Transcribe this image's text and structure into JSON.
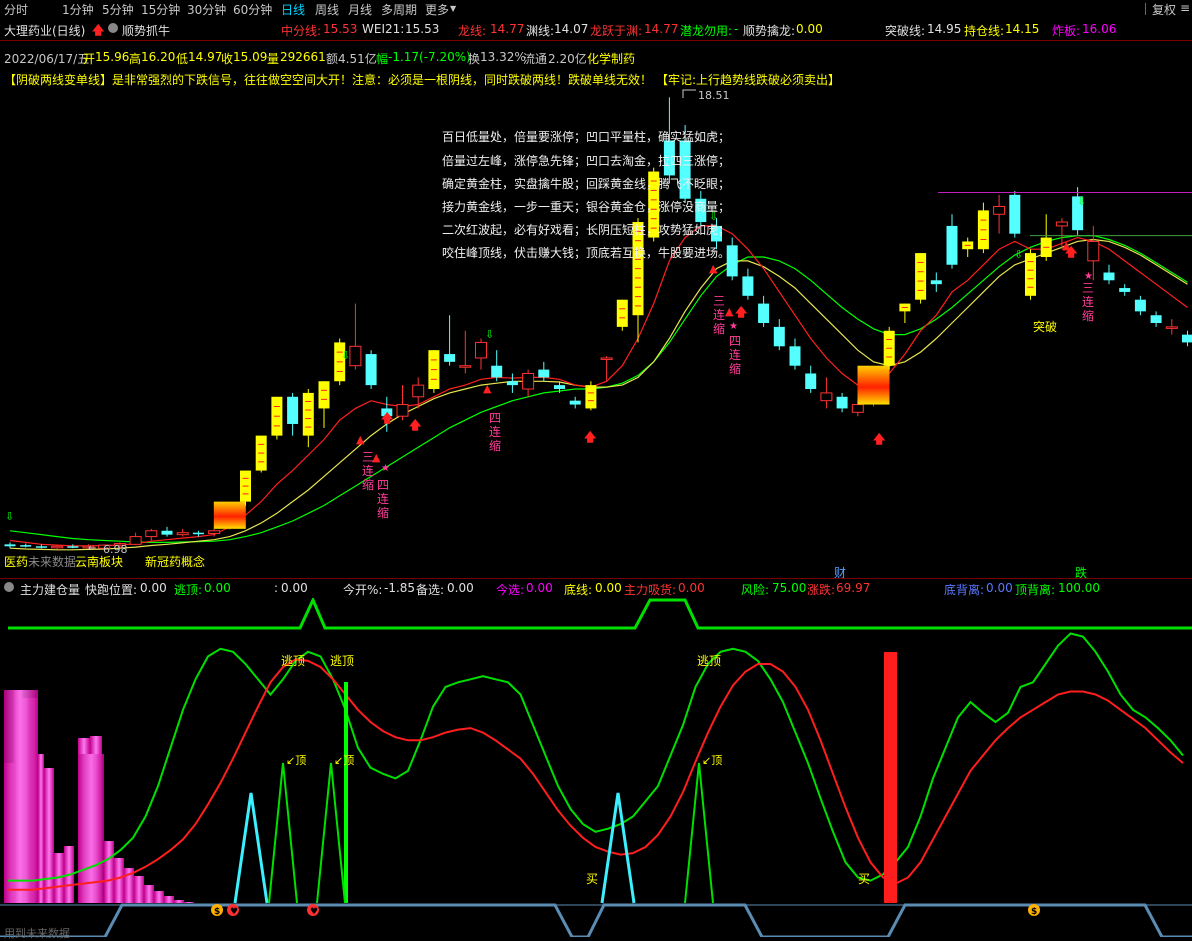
{
  "toolbar": {
    "tabs": [
      "分时",
      "1分钟",
      "5分钟",
      "15分钟",
      "30分钟",
      "60分钟",
      "日线",
      "周线",
      "月线",
      "多周期",
      "更多"
    ],
    "active": "日线",
    "restore": "复权",
    "menu": "≡"
  },
  "title": {
    "stock": "大理药业(日线)",
    "strategy": "顺势抓牛",
    "mid_label": "中分线:",
    "mid_value": "15.53",
    "wei_label": "WEI21:",
    "wei_value": "15.53",
    "long_label": "龙线:",
    "long_value": "14.77",
    "deep_label": "渊线:",
    "deep_value": "14.07",
    "jump_label": "龙跃于渊:",
    "jump_value": "14.77",
    "hide_label": "潜龙勿用:",
    "hide_value": "-",
    "trend_label": "顺势擒龙:",
    "trend_value": "0.00",
    "break_label": "突破线:",
    "break_value": "14.95",
    "hold_label": "持仓线:",
    "hold_value": "14.15",
    "burst_label": "炸板:",
    "burst_value": "16.06"
  },
  "info": {
    "date": "2022/06/17/五",
    "open_label": "开",
    "open": "15.96",
    "high_label": "高",
    "high": "16.20",
    "low_label": "低",
    "low": "14.97",
    "close_label": "收",
    "close": "15.09",
    "vol_label": "量",
    "vol": "292661",
    "amount_label": "额",
    "amount": "4.51亿",
    "chg_label": "幅",
    "chg": "-1.17(-7.20%)",
    "turn_label": "换",
    "turn": "13.32%",
    "float_label": "流通",
    "float": "2.20亿",
    "sector": "化学制药"
  },
  "warning": {
    "part1": "【阴破两线变单线】是非常强烈的下跌信号，往往做空空间大开！注意：必须是一根阴线，同时跌破两线！跌破单线无效！",
    "part2": "【牢记:上行趋势线跌破必须卖出】"
  },
  "poem": [
    "百日低量处，倍量要涨停；凹口平量柱，确实猛如虎；",
    "倍量过左峰，涨停急先锋；凹口去淘金，拉四三涨停；",
    "确定黄金柱，实盘擒牛股；回踩黄金线，腾飞不眨眼；",
    "接力黄金线，一步一重天；银谷黄金仓，涨停没商量；",
    "二次红波起，必有好戏看；长阴压短柱，攻势猛如虎；",
    "咬住峰顶线，伏击赚大钱；顶底若互换，牛股要进场。"
  ],
  "annotations": {
    "high_price": "18.51",
    "low_price": "6.98",
    "breakthrough": "突破",
    "three_shrink": "三连缩",
    "four_shrink": "四连缩",
    "sectors": [
      "医药",
      "未来数据",
      "云南板块",
      "新冠药概念"
    ],
    "cai": "财",
    "die": "跌"
  },
  "indicator": {
    "name": "主力建仓量",
    "quick_label": "快跑位置:",
    "quick": "0.00",
    "escape_label": "逃顶:",
    "escape": "0.00",
    "colon": ":",
    "colon_value": "0.00",
    "today_label": "今开%:",
    "today": "-1.85",
    "prep_label": "备选:",
    "prep": "0.00",
    "pick_label": "今选:",
    "pick": "0.00",
    "bottom_label": "底线:",
    "bottom": "0.00",
    "absorb_label": "主力吸货:",
    "absorb": "0.00",
    "risk_label": "风险:",
    "risk": "75.00",
    "rise_label": "涨跌:",
    "rise": "69.97",
    "bdiv_label": "底背离:",
    "bdiv": "0.00",
    "tdiv_label": "顶背离:",
    "tdiv": "100.00"
  },
  "sub_labels": {
    "escape": "逃顶",
    "top": "顶",
    "buy": "买",
    "bottom_text": "用到未来数据"
  },
  "colors": {
    "up": "#ff3232",
    "down": "#54ffff",
    "yellow": "#ffff00",
    "ma_red": "#ff2020",
    "ma_yellow": "#e6e650",
    "ma_green": "#00ff00",
    "magenta": "#ff00ff"
  },
  "candles": [
    {
      "o": 6.95,
      "h": 7.05,
      "l": 6.9,
      "c": 7.0,
      "k": "c"
    },
    {
      "o": 6.98,
      "h": 7.02,
      "l": 6.92,
      "c": 6.95,
      "k": "c"
    },
    {
      "o": 6.95,
      "h": 7.0,
      "l": 6.9,
      "c": 6.93,
      "k": "c"
    },
    {
      "o": 6.92,
      "h": 6.97,
      "l": 6.88,
      "c": 6.95,
      "k": "u"
    },
    {
      "o": 6.95,
      "h": 7.0,
      "l": 6.9,
      "c": 6.93,
      "k": "c"
    },
    {
      "o": 6.93,
      "h": 7.0,
      "l": 6.9,
      "c": 6.95,
      "k": "u"
    },
    {
      "o": 6.9,
      "h": 7.0,
      "l": 6.85,
      "c": 6.98,
      "k": "u"
    },
    {
      "o": 6.98,
      "h": 7.05,
      "l": 6.9,
      "c": 7.02,
      "k": "u"
    },
    {
      "o": 7.0,
      "h": 7.3,
      "l": 6.98,
      "c": 7.2,
      "k": "u"
    },
    {
      "o": 7.2,
      "h": 7.4,
      "l": 7.1,
      "c": 7.35,
      "k": "u"
    },
    {
      "o": 7.35,
      "h": 7.45,
      "l": 7.2,
      "c": 7.25,
      "k": "c"
    },
    {
      "o": 7.25,
      "h": 7.4,
      "l": 7.2,
      "c": 7.3,
      "k": "u"
    },
    {
      "o": 7.3,
      "h": 7.35,
      "l": 7.2,
      "c": 7.28,
      "k": "c"
    },
    {
      "o": 7.28,
      "h": 7.4,
      "l": 7.2,
      "c": 7.35,
      "k": "u"
    },
    {
      "o": 7.4,
      "h": 8.1,
      "l": 7.38,
      "c": 8.1,
      "k": "b"
    },
    {
      "o": 8.1,
      "h": 8.9,
      "l": 8.0,
      "c": 8.9,
      "k": "y"
    },
    {
      "o": 8.9,
      "h": 9.8,
      "l": 8.85,
      "c": 9.8,
      "k": "y"
    },
    {
      "o": 9.8,
      "h": 10.8,
      "l": 9.7,
      "c": 10.8,
      "k": "y"
    },
    {
      "o": 10.8,
      "h": 10.9,
      "l": 9.8,
      "c": 10.1,
      "k": "c"
    },
    {
      "o": 9.8,
      "h": 11.0,
      "l": 9.5,
      "c": 10.9,
      "k": "y"
    },
    {
      "o": 10.5,
      "h": 11.2,
      "l": 10.0,
      "c": 11.2,
      "k": "y"
    },
    {
      "o": 11.2,
      "h": 12.3,
      "l": 11.1,
      "c": 12.2,
      "k": "y"
    },
    {
      "o": 12.1,
      "h": 13.2,
      "l": 11.5,
      "c": 11.6,
      "k": "u"
    },
    {
      "o": 11.9,
      "h": 12.0,
      "l": 11.0,
      "c": 11.1,
      "k": "c"
    },
    {
      "o": 10.3,
      "h": 10.8,
      "l": 9.9,
      "c": 10.5,
      "k": "c"
    },
    {
      "o": 10.6,
      "h": 11.1,
      "l": 10.2,
      "c": 10.3,
      "k": "u"
    },
    {
      "o": 10.8,
      "h": 11.3,
      "l": 10.5,
      "c": 11.1,
      "k": "u"
    },
    {
      "o": 11.0,
      "h": 12.0,
      "l": 10.9,
      "c": 12.0,
      "k": "y"
    },
    {
      "o": 11.7,
      "h": 12.9,
      "l": 11.6,
      "c": 11.9,
      "k": "c"
    },
    {
      "o": 11.6,
      "h": 12.5,
      "l": 11.4,
      "c": 11.6,
      "k": "u"
    },
    {
      "o": 11.8,
      "h": 12.3,
      "l": 11.5,
      "c": 12.2,
      "k": "u"
    },
    {
      "o": 11.6,
      "h": 12.0,
      "l": 11.2,
      "c": 11.3,
      "k": "c"
    },
    {
      "o": 11.1,
      "h": 11.4,
      "l": 10.9,
      "c": 11.2,
      "k": "c"
    },
    {
      "o": 11.0,
      "h": 11.5,
      "l": 10.8,
      "c": 11.4,
      "k": "u"
    },
    {
      "o": 11.5,
      "h": 11.7,
      "l": 11.2,
      "c": 11.3,
      "k": "c"
    },
    {
      "o": 11.1,
      "h": 11.2,
      "l": 10.9,
      "c": 11.0,
      "k": "c"
    },
    {
      "o": 10.7,
      "h": 10.8,
      "l": 10.5,
      "c": 10.6,
      "k": "c"
    },
    {
      "o": 10.5,
      "h": 11.2,
      "l": 10.45,
      "c": 11.1,
      "k": "y"
    },
    {
      "o": 11.8,
      "h": 11.85,
      "l": 11.2,
      "c": 11.8,
      "k": "u"
    },
    {
      "o": 12.6,
      "h": 13.3,
      "l": 12.5,
      "c": 13.3,
      "k": "y"
    },
    {
      "o": 12.9,
      "h": 15.4,
      "l": 12.2,
      "c": 15.3,
      "k": "y"
    },
    {
      "o": 14.9,
      "h": 16.7,
      "l": 14.8,
      "c": 16.6,
      "k": "y"
    },
    {
      "o": 16.5,
      "h": 18.51,
      "l": 16.3,
      "c": 17.4,
      "k": "c"
    },
    {
      "o": 17.4,
      "h": 17.8,
      "l": 15.8,
      "c": 15.9,
      "k": "c"
    },
    {
      "o": 15.9,
      "h": 16.1,
      "l": 15.2,
      "c": 15.3,
      "k": "c"
    },
    {
      "o": 15.2,
      "h": 15.4,
      "l": 14.6,
      "c": 14.8,
      "k": "c"
    },
    {
      "o": 14.7,
      "h": 14.9,
      "l": 13.8,
      "c": 13.9,
      "k": "c"
    },
    {
      "o": 13.9,
      "h": 14.1,
      "l": 13.3,
      "c": 13.4,
      "k": "c"
    },
    {
      "o": 13.2,
      "h": 13.4,
      "l": 12.6,
      "c": 12.7,
      "k": "c"
    },
    {
      "o": 12.6,
      "h": 12.8,
      "l": 12.0,
      "c": 12.1,
      "k": "c"
    },
    {
      "o": 12.1,
      "h": 12.3,
      "l": 11.5,
      "c": 11.6,
      "k": "c"
    },
    {
      "o": 11.4,
      "h": 11.6,
      "l": 10.9,
      "c": 11.0,
      "k": "c"
    },
    {
      "o": 10.7,
      "h": 11.3,
      "l": 10.5,
      "c": 10.9,
      "k": "u"
    },
    {
      "o": 10.8,
      "h": 10.9,
      "l": 10.4,
      "c": 10.5,
      "k": "c"
    },
    {
      "o": 10.4,
      "h": 10.7,
      "l": 10.3,
      "c": 10.6,
      "k": "u"
    },
    {
      "o": 10.6,
      "h": 11.6,
      "l": 10.55,
      "c": 11.6,
      "k": "b"
    },
    {
      "o": 11.6,
      "h": 12.6,
      "l": 11.5,
      "c": 12.5,
      "k": "y"
    },
    {
      "o": 13.0,
      "h": 13.2,
      "l": 12.7,
      "c": 13.2,
      "k": "y"
    },
    {
      "o": 13.3,
      "h": 14.5,
      "l": 13.2,
      "c": 14.5,
      "k": "y"
    },
    {
      "o": 13.7,
      "h": 14.0,
      "l": 13.5,
      "c": 13.8,
      "k": "c"
    },
    {
      "o": 14.2,
      "h": 15.5,
      "l": 14.1,
      "c": 15.2,
      "k": "c"
    },
    {
      "o": 14.8,
      "h": 14.9,
      "l": 14.4,
      "c": 14.6,
      "k": "y"
    },
    {
      "o": 14.6,
      "h": 15.8,
      "l": 14.5,
      "c": 15.6,
      "k": "y"
    },
    {
      "o": 15.5,
      "h": 16.0,
      "l": 15.0,
      "c": 15.7,
      "k": "u"
    },
    {
      "o": 16.0,
      "h": 16.1,
      "l": 14.9,
      "c": 15.0,
      "k": "c"
    },
    {
      "o": 14.5,
      "h": 14.6,
      "l": 13.3,
      "c": 13.4,
      "k": "y"
    },
    {
      "o": 14.4,
      "h": 15.5,
      "l": 14.3,
      "c": 14.9,
      "k": "y"
    },
    {
      "o": 15.2,
      "h": 15.4,
      "l": 14.6,
      "c": 15.3,
      "k": "u"
    },
    {
      "o": 15.96,
      "h": 16.2,
      "l": 14.97,
      "c": 15.09,
      "k": "c"
    },
    {
      "o": 14.8,
      "h": 15.2,
      "l": 13.8,
      "c": 14.3,
      "k": "u"
    },
    {
      "o": 14.0,
      "h": 14.2,
      "l": 13.7,
      "c": 13.8,
      "k": "c"
    },
    {
      "o": 13.6,
      "h": 13.7,
      "l": 13.4,
      "c": 13.5,
      "k": "c"
    },
    {
      "o": 13.3,
      "h": 13.4,
      "l": 12.9,
      "c": 13.0,
      "k": "c"
    },
    {
      "o": 12.9,
      "h": 13.0,
      "l": 12.6,
      "c": 12.7,
      "k": "c"
    },
    {
      "o": 12.6,
      "h": 12.8,
      "l": 12.4,
      "c": 12.6,
      "k": "u"
    },
    {
      "o": 12.4,
      "h": 12.5,
      "l": 12.1,
      "c": 12.2,
      "k": "c"
    }
  ],
  "ma_red": [
    7.1,
    7.05,
    7.0,
    6.98,
    6.96,
    6.96,
    6.97,
    6.98,
    7.02,
    7.08,
    7.12,
    7.16,
    7.2,
    7.25,
    7.45,
    7.75,
    8.1,
    8.55,
    8.9,
    9.3,
    9.7,
    10.2,
    10.5,
    10.7,
    10.6,
    10.55,
    10.6,
    10.8,
    11.0,
    11.1,
    11.25,
    11.3,
    11.28,
    11.3,
    11.3,
    11.25,
    11.1,
    11.05,
    11.2,
    11.6,
    12.3,
    13.2,
    14.3,
    14.9,
    15.2,
    15.2,
    15.0,
    14.6,
    14.1,
    13.5,
    12.9,
    12.3,
    11.8,
    11.4,
    11.1,
    11.1,
    11.4,
    11.9,
    12.5,
    12.9,
    13.5,
    13.8,
    14.2,
    14.6,
    14.8,
    14.6,
    14.6,
    14.75,
    14.9,
    14.8,
    14.6,
    14.3,
    14.0,
    13.7,
    13.4,
    13.1
  ],
  "ma_yellow": [
    6.9,
    6.88,
    6.87,
    6.86,
    6.86,
    6.87,
    6.88,
    6.9,
    6.93,
    6.97,
    7.0,
    7.04,
    7.08,
    7.12,
    7.2,
    7.35,
    7.55,
    7.8,
    8.1,
    8.4,
    8.75,
    9.1,
    9.45,
    9.8,
    10.1,
    10.35,
    10.55,
    10.75,
    10.9,
    11.0,
    11.1,
    11.15,
    11.2,
    11.2,
    11.2,
    11.18,
    11.1,
    11.05,
    11.05,
    11.1,
    11.3,
    11.7,
    12.3,
    13.0,
    13.6,
    14.1,
    14.3,
    14.3,
    14.15,
    13.9,
    13.6,
    13.2,
    12.8,
    12.4,
    12.0,
    11.7,
    11.6,
    11.7,
    11.95,
    12.3,
    12.7,
    13.1,
    13.5,
    13.9,
    14.2,
    14.35,
    14.5,
    14.65,
    14.8,
    14.85,
    14.8,
    14.65,
    14.45,
    14.2,
    13.95,
    13.7
  ],
  "ma_green": [
    7.35,
    7.3,
    7.25,
    7.2,
    7.15,
    7.12,
    7.1,
    7.08,
    7.06,
    7.05,
    7.05,
    7.06,
    7.07,
    7.08,
    7.12,
    7.2,
    7.3,
    7.45,
    7.6,
    7.8,
    8.0,
    8.25,
    8.5,
    8.75,
    9.0,
    9.25,
    9.5,
    9.75,
    10.0,
    10.2,
    10.4,
    10.55,
    10.7,
    10.8,
    10.9,
    10.95,
    11.0,
    11.0,
    11.05,
    11.15,
    11.35,
    11.7,
    12.2,
    12.8,
    13.4,
    13.9,
    14.2,
    14.4,
    14.4,
    14.3,
    14.1,
    13.8,
    13.45,
    13.1,
    12.8,
    12.55,
    12.4,
    12.4,
    12.55,
    12.8,
    13.1,
    13.45,
    13.8,
    14.15,
    14.45,
    14.65,
    14.8,
    14.9,
    14.95,
    14.95,
    14.85,
    14.7,
    14.5,
    14.25,
    14.0,
    13.75
  ],
  "sub": {
    "green": [
      18,
      18,
      18,
      19,
      20,
      22,
      25,
      28,
      32,
      38,
      46,
      60,
      80,
      105,
      130,
      150,
      165,
      170,
      168,
      160,
      150,
      140,
      150,
      162,
      168,
      165,
      150,
      130,
      105,
      92,
      88,
      85,
      90,
      110,
      132,
      145,
      148,
      150,
      152,
      150,
      148,
      140,
      120,
      100,
      80,
      65,
      55,
      50,
      52,
      55,
      60,
      70,
      80,
      100,
      120,
      145,
      160,
      168,
      170,
      168,
      162,
      150,
      135,
      115,
      95,
      72,
      50,
      30,
      20,
      18,
      22,
      30,
      40,
      60,
      85,
      105,
      125,
      135,
      128,
      122,
      128,
      145,
      148,
      160,
      172,
      180,
      178,
      168,
      155,
      140,
      130,
      125,
      118,
      110,
      100
    ],
    "red": [
      12,
      12,
      12,
      13,
      14,
      15,
      16,
      17,
      18,
      20,
      23,
      27,
      32,
      38,
      45,
      55,
      68,
      82,
      98,
      115,
      132,
      148,
      158,
      163,
      162,
      158,
      150,
      140,
      130,
      122,
      116,
      112,
      110,
      110,
      112,
      115,
      117,
      118,
      115,
      110,
      104,
      98,
      88,
      76,
      64,
      54,
      46,
      40,
      37,
      35,
      36,
      40,
      48,
      60,
      76,
      96,
      115,
      132,
      146,
      155,
      160,
      160,
      155,
      145,
      130,
      110,
      88,
      66,
      46,
      30,
      20,
      16,
      20,
      30,
      45,
      60,
      75,
      90,
      100,
      110,
      118,
      125,
      130,
      135,
      140,
      142,
      142,
      140,
      136,
      130,
      124,
      118,
      110,
      102,
      95
    ]
  }
}
